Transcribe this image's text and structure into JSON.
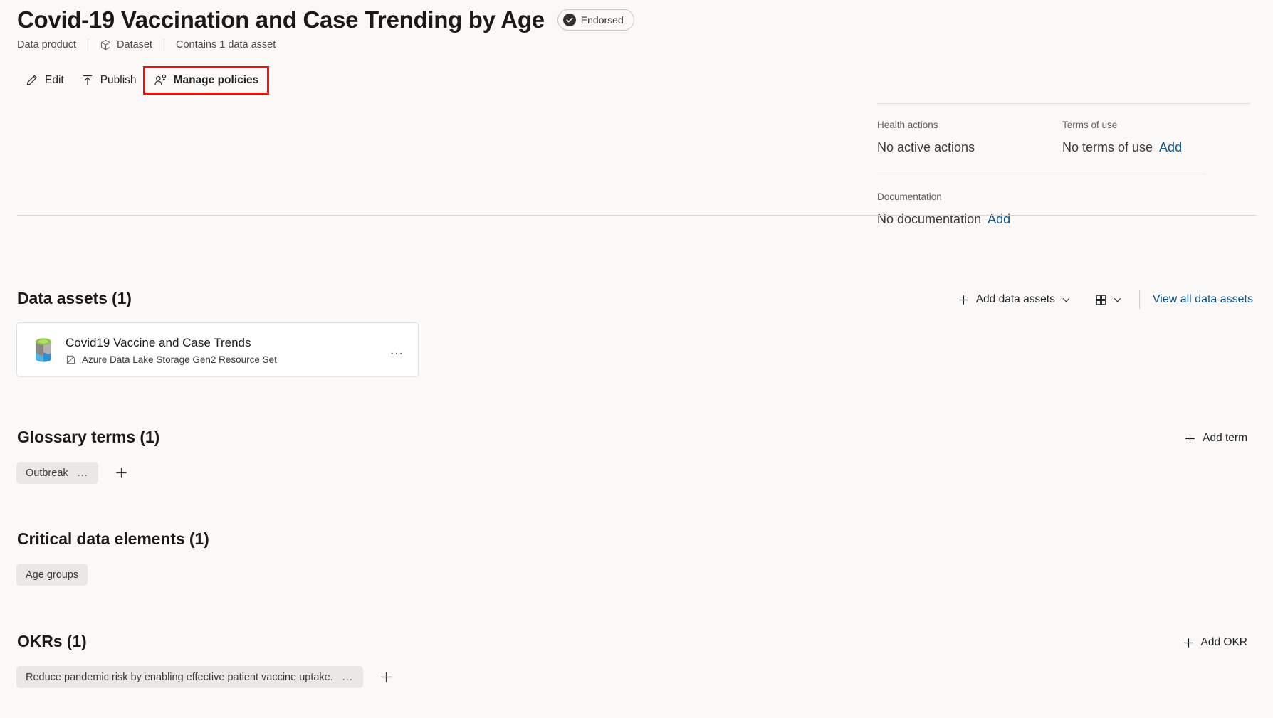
{
  "header": {
    "title": "Covid-19 Vaccination and Case Trending by Age",
    "endorsed_label": "Endorsed",
    "endorsed_icon": "check-circle-filled-icon"
  },
  "breadcrumb": {
    "type_label": "Data product",
    "kind_label": "Dataset",
    "kind_icon": "cube-icon",
    "asset_count_label": "Contains 1 data asset"
  },
  "commandbar": {
    "edit_label": "Edit",
    "edit_icon": "pencil-icon",
    "publish_label": "Publish",
    "publish_icon": "publish-arrow-up-icon",
    "manage_policies_label": "Manage policies",
    "manage_policies_icon": "person-key-icon",
    "highlight_color": "#e8130f"
  },
  "info_panel": {
    "health_actions": {
      "label": "Health actions",
      "value": "No active actions"
    },
    "terms_of_use": {
      "label": "Terms of use",
      "value": "No terms of use",
      "add_label": "Add"
    },
    "documentation": {
      "label": "Documentation",
      "value": "No documentation",
      "add_label": "Add"
    }
  },
  "data_assets": {
    "section_title": "Data assets (1)",
    "add_label": "Add data assets",
    "add_icon": "plus-icon",
    "add_chevron_icon": "chevron-down-icon",
    "view_mode_icon": "grid-view-icon",
    "view_mode_chevron_icon": "chevron-down-icon",
    "view_all_label": "View all data assets",
    "items": [
      {
        "name": "Covid19 Vaccine and Case Trends",
        "type": "Azure Data Lake Storage Gen2 Resource Set",
        "icon": "azure-data-lake-cylinder-icon",
        "type_icon": "resource-set-icon",
        "more_label": "…"
      }
    ]
  },
  "glossary_terms": {
    "section_title": "Glossary terms (1)",
    "add_label": "Add term",
    "add_icon": "plus-icon",
    "chips": [
      {
        "label": "Outbreak",
        "more_label": "…"
      }
    ],
    "add_chip_icon": "plus-icon"
  },
  "critical_data_elements": {
    "section_title": "Critical data elements (1)",
    "chips": [
      {
        "label": "Age groups"
      }
    ]
  },
  "okrs": {
    "section_title": "OKRs (1)",
    "add_label": "Add OKR",
    "add_icon": "plus-icon",
    "chips": [
      {
        "label": "Reduce pandemic risk by enabling effective patient vaccine uptake.",
        "more_label": "…"
      }
    ],
    "add_chip_icon": "plus-icon"
  },
  "colors": {
    "page_bg": "#faf9f8",
    "link": "#0f548c",
    "chip_bg": "#e9e8e7",
    "card_bg": "#ffffff",
    "divider": "#e1dfdd",
    "highlight": "#e8130f"
  }
}
